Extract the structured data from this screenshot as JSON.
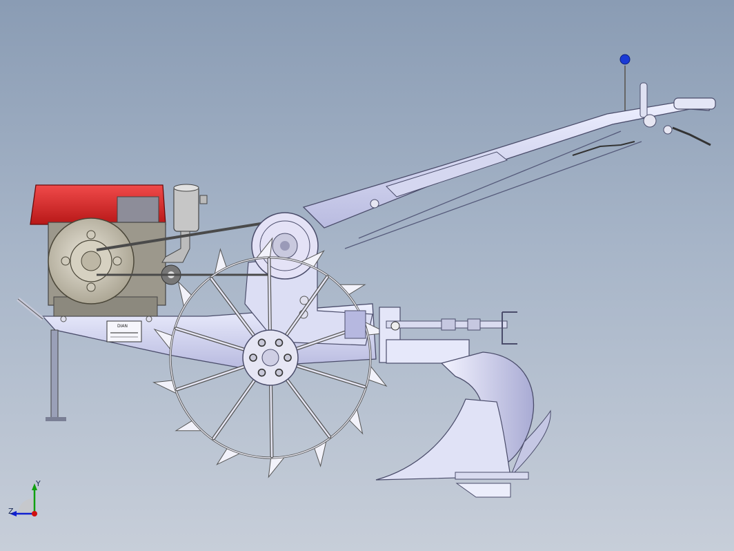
{
  "viewport": {
    "background_top": "#8a9cb4",
    "background_bottom": "#c7ced9"
  },
  "model": {
    "engine_color": "#e02424",
    "frame_color": "#d6d8f2",
    "metal_color": "#c9cbd6",
    "knob_color": "#1a3ad6",
    "nameplate_text": "DIAN"
  },
  "triad": {
    "y_label": "Y",
    "z_label": "Z",
    "x_axis_color": "#d01010",
    "y_axis_color": "#10a010",
    "z_axis_color": "#1020d0"
  }
}
